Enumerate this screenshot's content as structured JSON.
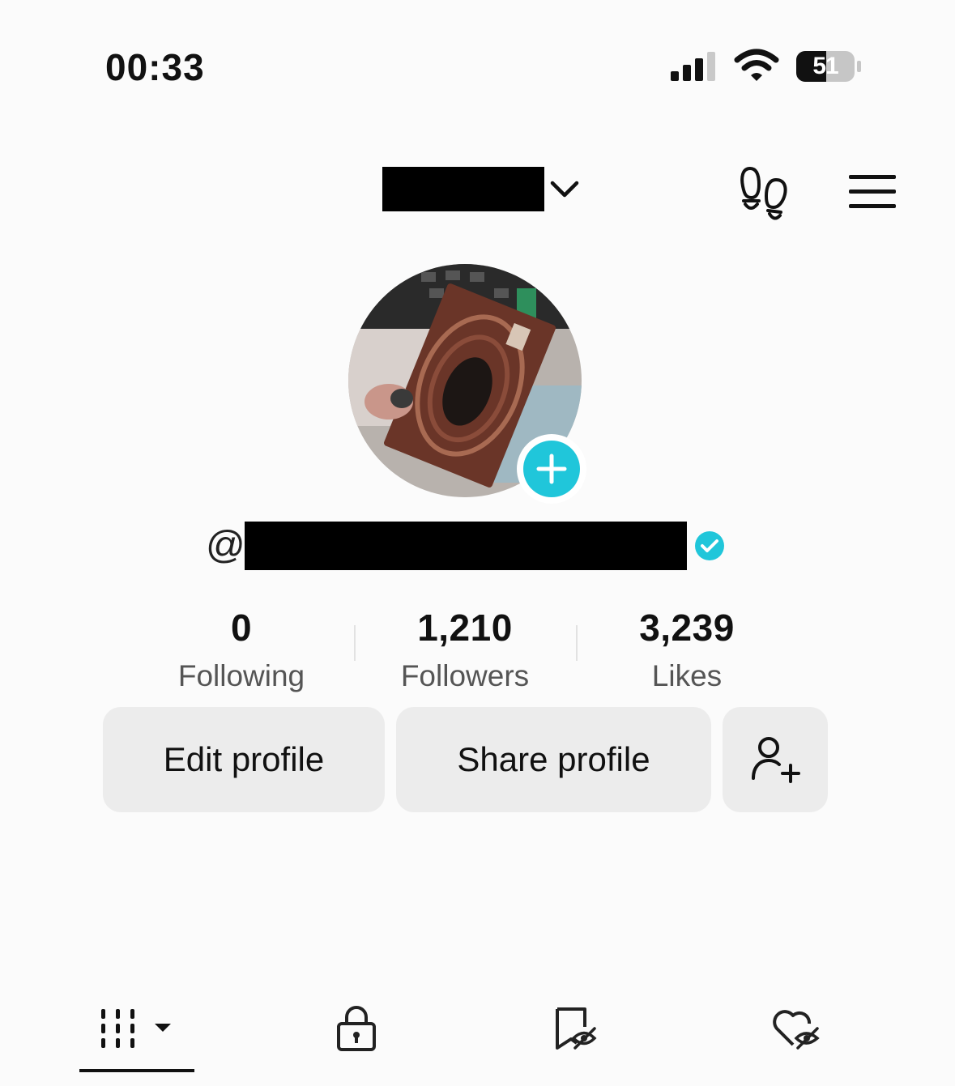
{
  "status_bar": {
    "time": "00:33",
    "battery_level": "51",
    "icons": [
      "cellular-signal-icon",
      "wifi-icon",
      "battery-icon"
    ]
  },
  "header": {
    "account_name_redacted": true,
    "icons": [
      "chevron-down-icon",
      "footprints-icon",
      "hamburger-menu-icon"
    ]
  },
  "profile": {
    "at_symbol": "@",
    "username_redacted": true,
    "verified": true,
    "avatar_add_icon": "plus-icon"
  },
  "stats": [
    {
      "value": "0",
      "label": "Following"
    },
    {
      "value": "1,210",
      "label": "Followers"
    },
    {
      "value": "3,239",
      "label": "Likes"
    }
  ],
  "actions": {
    "edit_label": "Edit profile",
    "share_label": "Share profile",
    "add_friend_icon": "add-friend-icon"
  },
  "tabs": [
    {
      "icon": "videos-grid-icon",
      "active": true
    },
    {
      "icon": "lock-icon",
      "active": false
    },
    {
      "icon": "hidden-reposts-icon",
      "active": false
    },
    {
      "icon": "hidden-likes-icon",
      "active": false
    }
  ],
  "colors": {
    "accent": "#20c6da",
    "verified": "#20c6da",
    "button_bg": "#ececec",
    "background": "#fbfbfb"
  }
}
